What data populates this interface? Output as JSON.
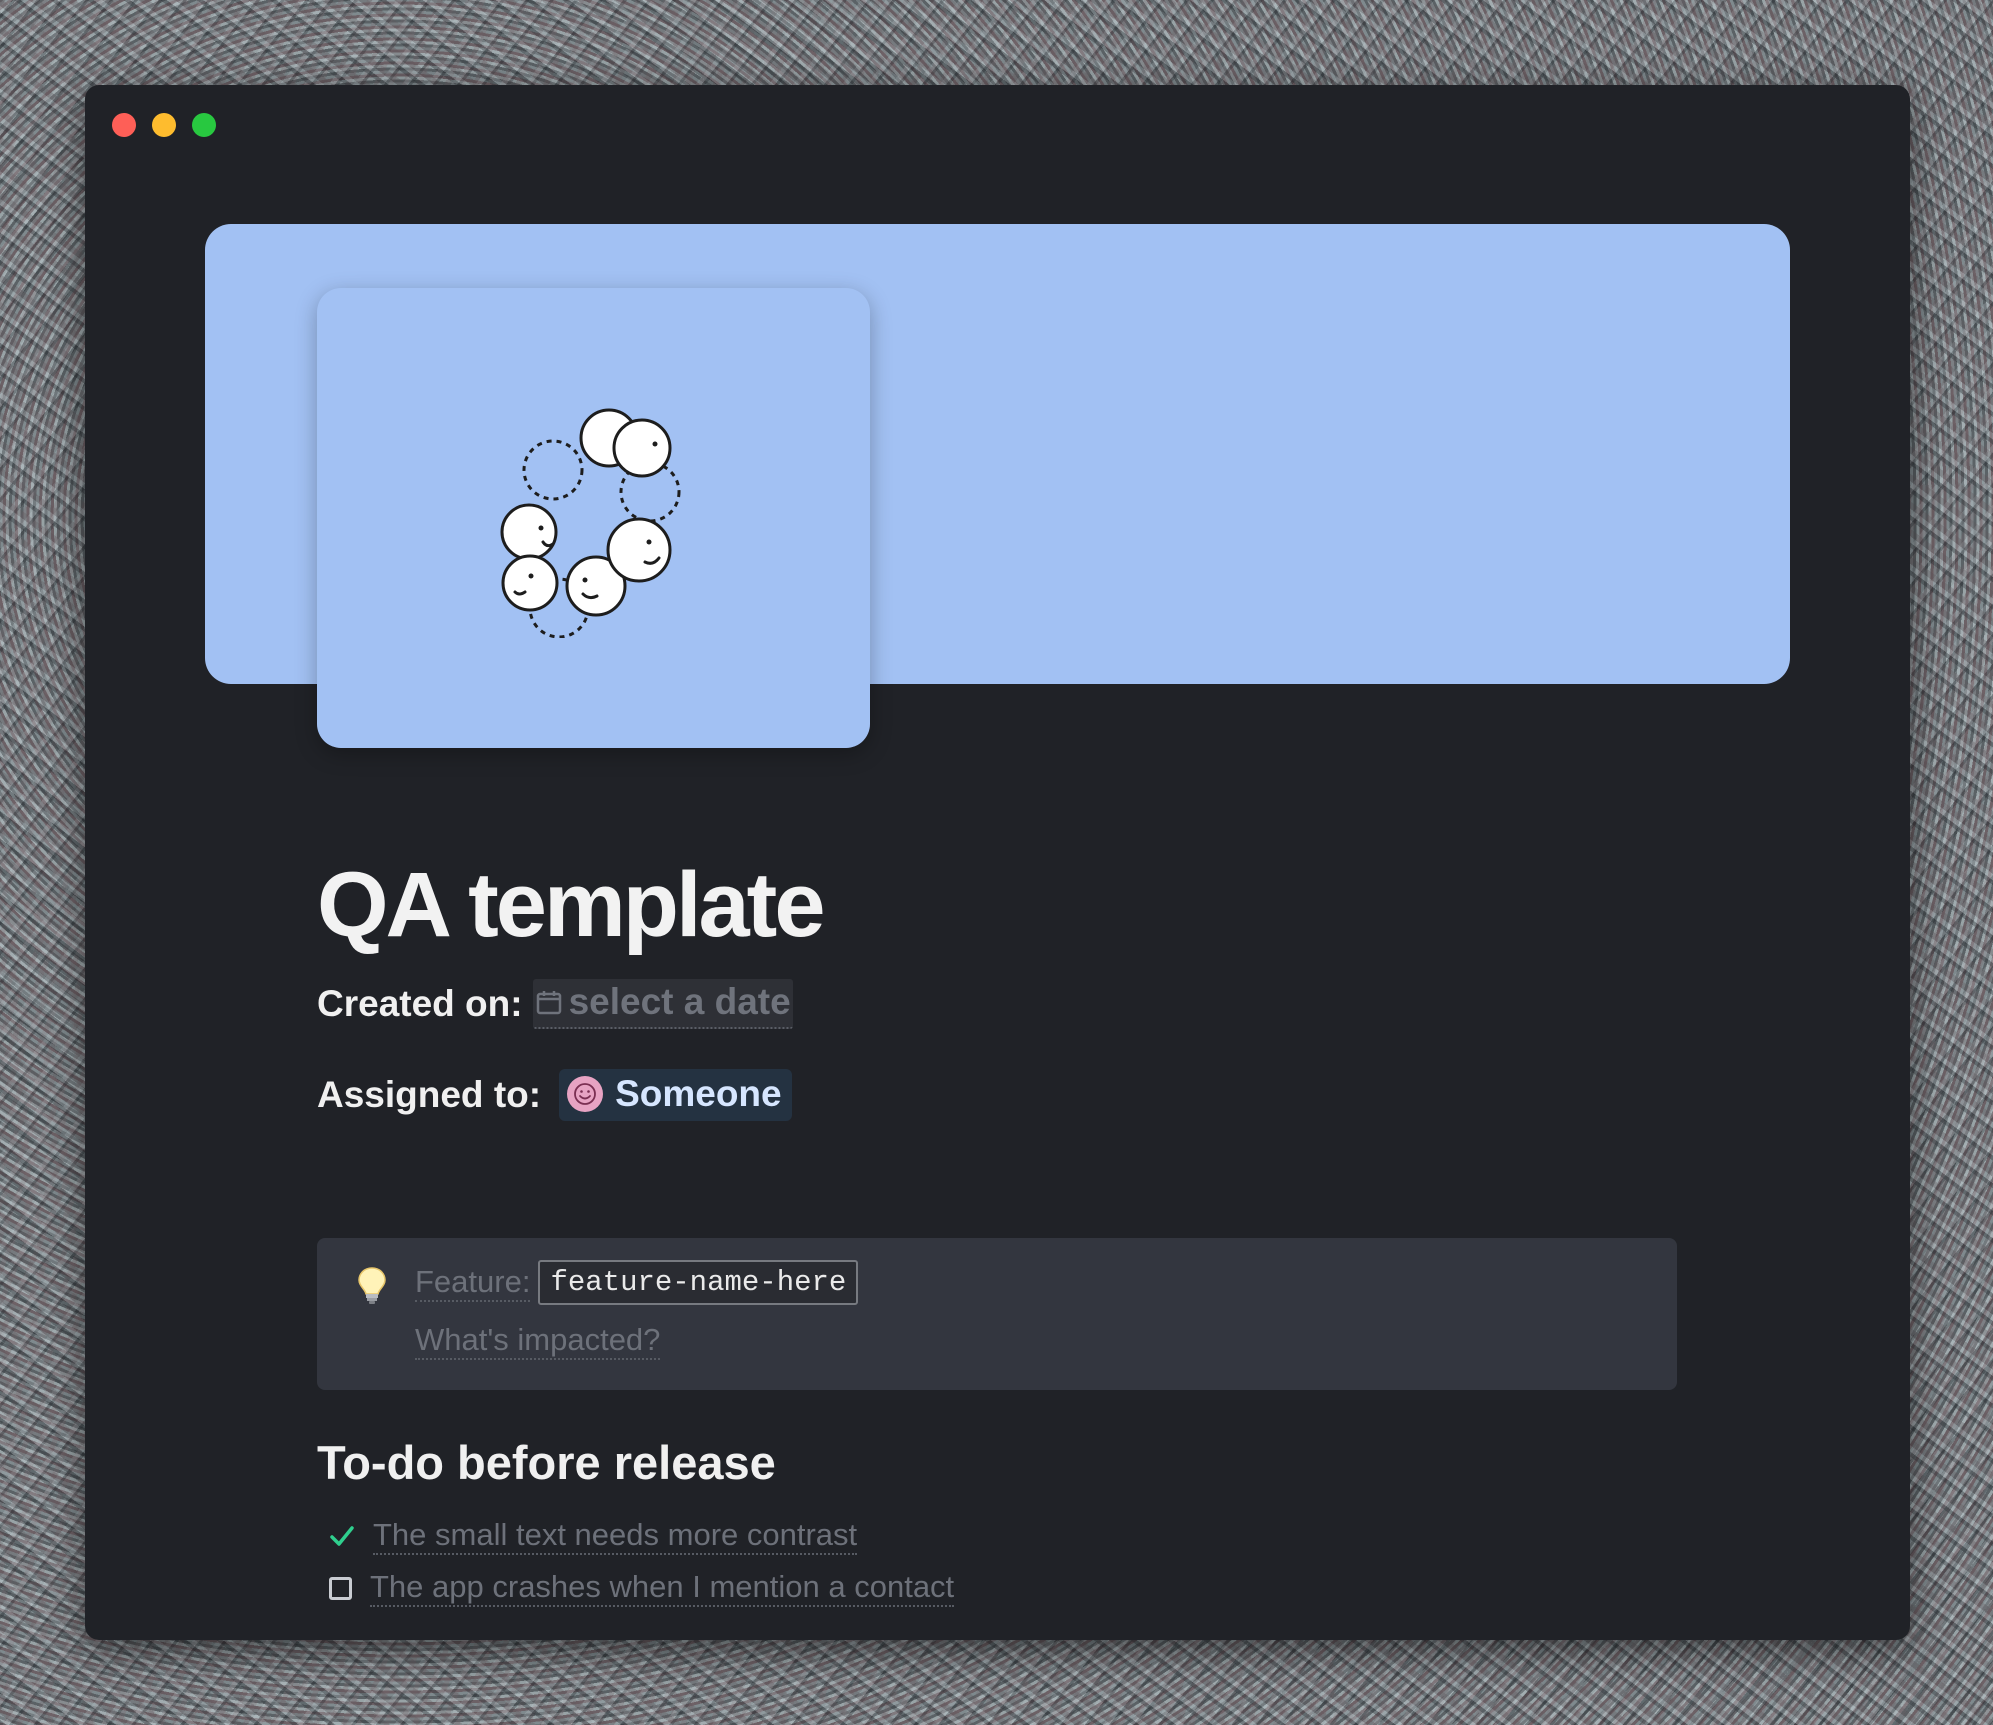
{
  "window": {
    "controls": [
      "close",
      "minimize",
      "zoom"
    ]
  },
  "page": {
    "title": "QA template",
    "cover_color": "#a2c1f3",
    "icon": "people-circle-illustration"
  },
  "properties": {
    "created_on": {
      "label": "Created on:",
      "value": "select a date",
      "icon": "calendar-icon"
    },
    "assigned_to": {
      "label": "Assigned to:",
      "value": "Someone",
      "icon": "smiley-avatar-icon"
    }
  },
  "callout": {
    "icon": "lightbulb-icon",
    "feature_label": "Feature:",
    "feature_value": "feature-name-here",
    "impacted_placeholder": "What's impacted?"
  },
  "todo_section": {
    "heading": "To-do before release",
    "items": [
      {
        "text": "The small text needs more contrast",
        "done": true
      },
      {
        "text": "The app crashes when I mention a contact",
        "done": false
      }
    ]
  },
  "colors": {
    "window_bg": "#202227",
    "accent_check": "#2fcf8e",
    "muted_text": "#6d717a"
  }
}
